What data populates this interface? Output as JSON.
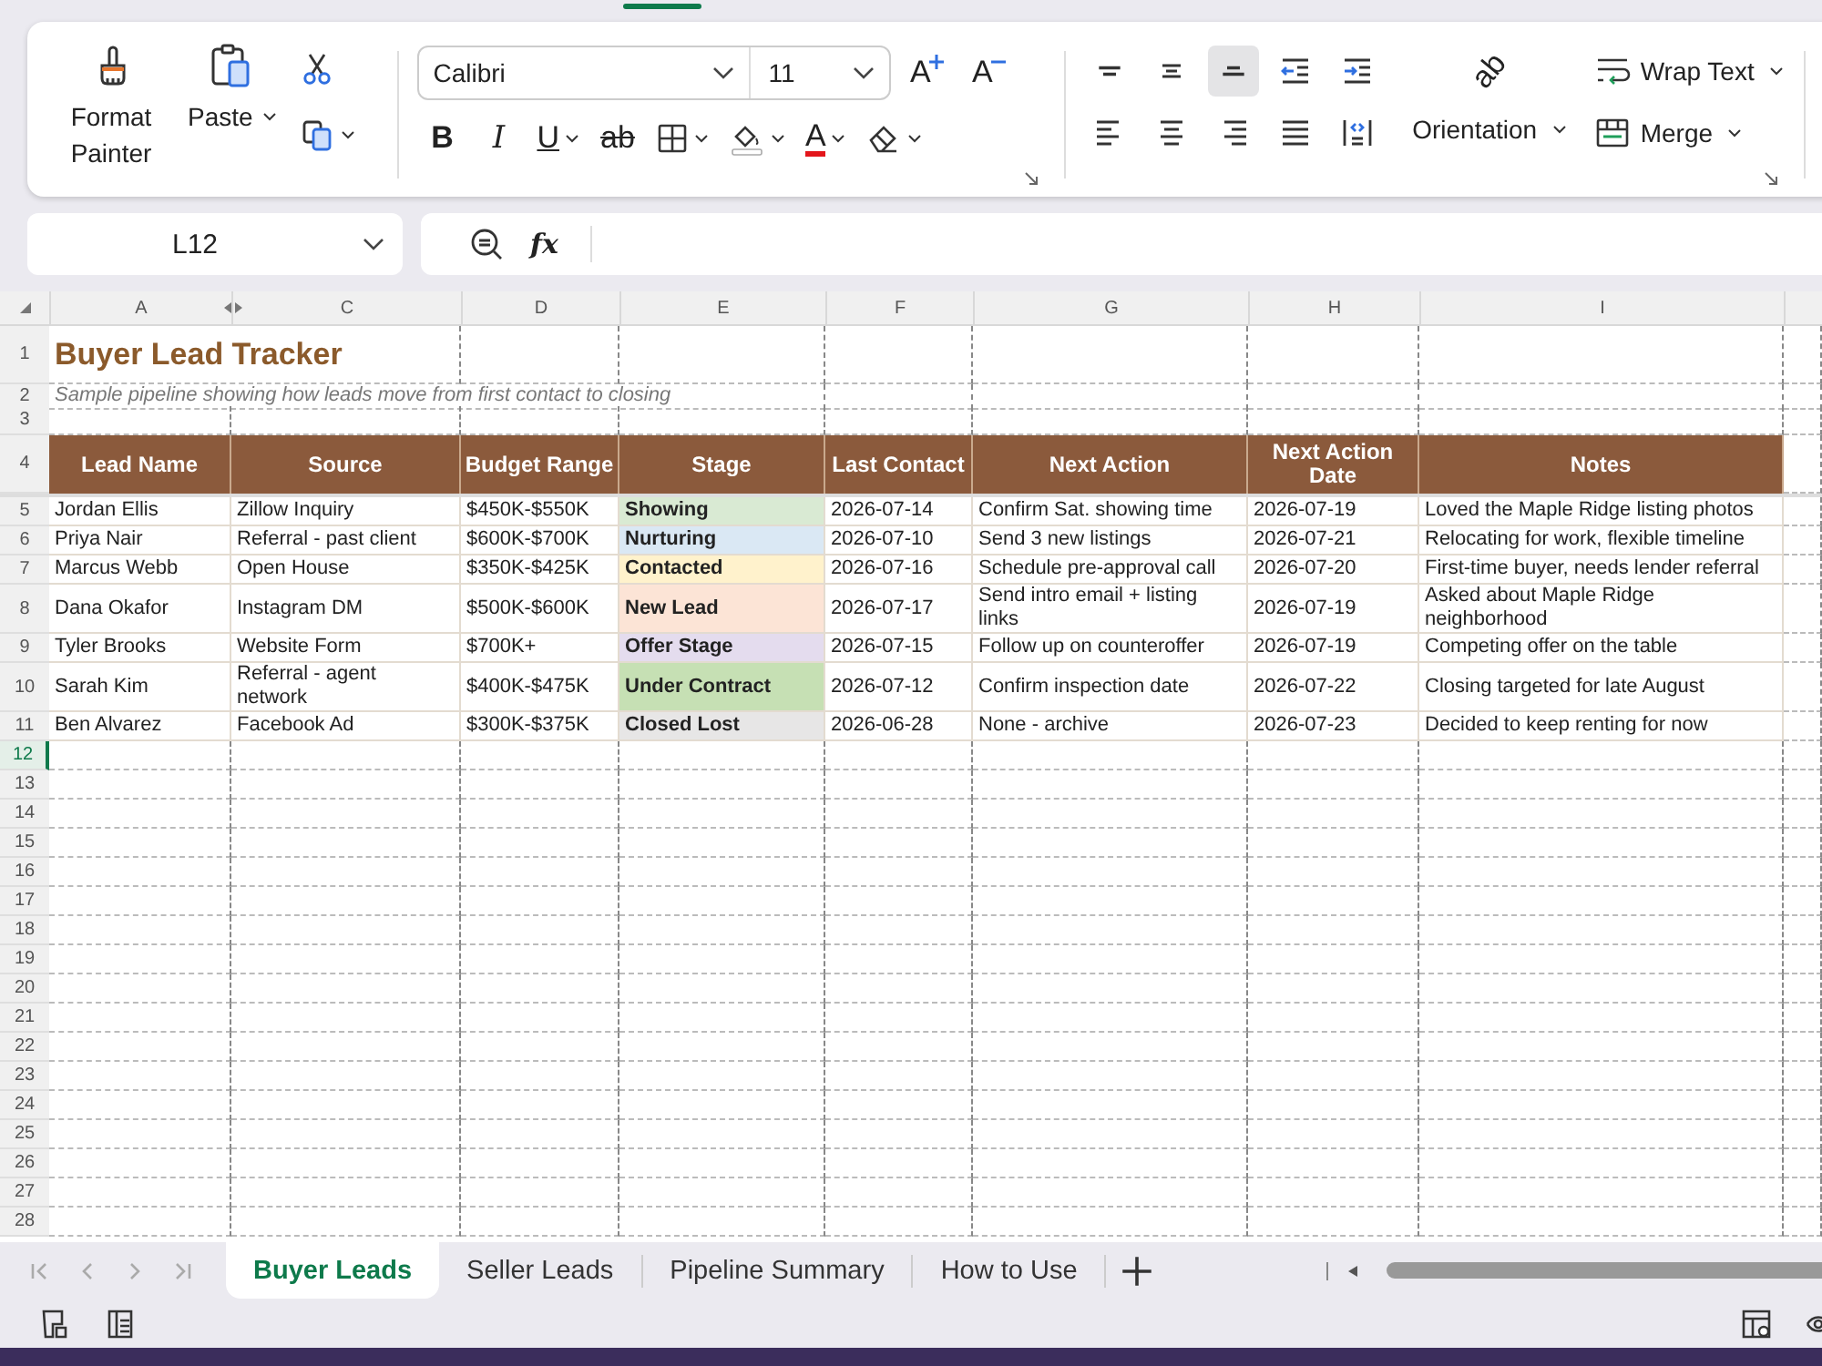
{
  "ribbon": {
    "clipboard": {
      "format_painter": "Format Painter",
      "paste": "Paste"
    },
    "font": {
      "name": "Calibri",
      "size": "11",
      "grow": "A",
      "shrink": "A",
      "bold": "B",
      "italic": "I",
      "underline": "U",
      "strikethrough": "ab",
      "font_color": "A"
    },
    "alignment": {
      "buttons": [
        {
          "kind": "top",
          "selected": false
        },
        {
          "kind": "middle",
          "selected": false
        },
        {
          "kind": "bottom",
          "selected": true
        },
        {
          "kind": "outdent",
          "selected": false
        },
        {
          "kind": "indent",
          "selected": false
        },
        {
          "kind": "left",
          "selected": false
        },
        {
          "kind": "center",
          "selected": false
        },
        {
          "kind": "right",
          "selected": false
        },
        {
          "kind": "justify",
          "selected": false
        },
        {
          "kind": "distributed",
          "selected": false
        }
      ],
      "orientation_glyph": "ab",
      "orientation": "Orientation",
      "wrap_text": "Wrap Text",
      "merge": "Merge"
    }
  },
  "formula_bar": {
    "name_box": "L12",
    "fx": "fx"
  },
  "sheet": {
    "columns": [
      "A",
      "C",
      "D",
      "E",
      "F",
      "G",
      "H",
      "I"
    ],
    "title_row": {
      "number": "1",
      "text": "Buyer Lead Tracker"
    },
    "subtitle_row": {
      "number": "2",
      "text": "Sample pipeline showing how leads move from first contact to closing"
    },
    "spacer_row": {
      "number": "3"
    },
    "header_row": {
      "number": "4",
      "headers": [
        "Lead Name",
        "Source",
        "Budget Range",
        "Stage",
        "Last Contact",
        "Next Action",
        "Next Action Date",
        "Notes"
      ]
    },
    "data_rows": [
      {
        "number": "5",
        "cells": [
          "Jordan Ellis",
          "Zillow Inquiry",
          "$450K-$550K",
          "Showing",
          "2026-07-14",
          "Confirm Sat. showing time",
          "2026-07-19",
          "Loved the Maple Ridge listing photos"
        ],
        "color": "#d9ead3"
      },
      {
        "number": "6",
        "cells": [
          "Priya Nair",
          "Referral - past client",
          "$600K-$700K",
          "Nurturing",
          "2026-07-10",
          "Send 3 new listings",
          "2026-07-21",
          "Relocating for work, flexible timeline"
        ],
        "color": "#dae8f4"
      },
      {
        "number": "7",
        "cells": [
          "Marcus Webb",
          "Open House",
          "$350K-$425K",
          "Contacted",
          "2026-07-16",
          "Schedule pre-approval call",
          "2026-07-20",
          "First-time buyer, needs lender referral"
        ],
        "color": "#fff2cc"
      },
      {
        "number": "8",
        "cells": [
          "Dana Okafor",
          "Instagram DM",
          "$500K-$600K",
          "New Lead",
          "2026-07-17",
          "Send intro email + listing links",
          "2026-07-19",
          "Asked about Maple Ridge neighborhood"
        ],
        "color": "#fce4d6"
      },
      {
        "number": "9",
        "cells": [
          "Tyler Brooks",
          "Website Form",
          "$700K+",
          "Offer Stage",
          "2026-07-15",
          "Follow up on counteroffer",
          "2026-07-19",
          "Competing offer on the table"
        ],
        "color": "#e4dcee"
      },
      {
        "number": "10",
        "cells": [
          "Sarah Kim",
          "Referral - agent network",
          "$400K-$475K",
          "Under Contract",
          "2026-07-12",
          "Confirm inspection date",
          "2026-07-22",
          "Closing targeted for late August"
        ],
        "color": "#c6e0b4"
      },
      {
        "number": "11",
        "cells": [
          "Ben Alvarez",
          "Facebook Ad",
          "$300K-$375K",
          "Closed Lost",
          "2026-06-28",
          "None - archive",
          "2026-07-23",
          "Decided to keep renting for now"
        ],
        "color": "#e7e6e6"
      }
    ],
    "blank_rows": [
      {
        "number": "12",
        "selected": true
      },
      {
        "number": "13",
        "selected": false
      },
      {
        "number": "14",
        "selected": false
      },
      {
        "number": "15",
        "selected": false
      },
      {
        "number": "16",
        "selected": false
      },
      {
        "number": "17",
        "selected": false
      },
      {
        "number": "18",
        "selected": false
      },
      {
        "number": "19",
        "selected": false
      },
      {
        "number": "20",
        "selected": false
      },
      {
        "number": "21",
        "selected": false
      },
      {
        "number": "22",
        "selected": false
      },
      {
        "number": "23",
        "selected": false
      },
      {
        "number": "24",
        "selected": false
      },
      {
        "number": "25",
        "selected": false
      },
      {
        "number": "26",
        "selected": false
      },
      {
        "number": "27",
        "selected": false
      },
      {
        "number": "28",
        "selected": false
      }
    ]
  },
  "sheet_tabs": [
    {
      "label": "Buyer Leads",
      "selected": true
    },
    {
      "label": "Seller Leads",
      "selected": false
    },
    {
      "label": "Pipeline Summary",
      "selected": false
    },
    {
      "label": "How to Use",
      "selected": false
    }
  ]
}
